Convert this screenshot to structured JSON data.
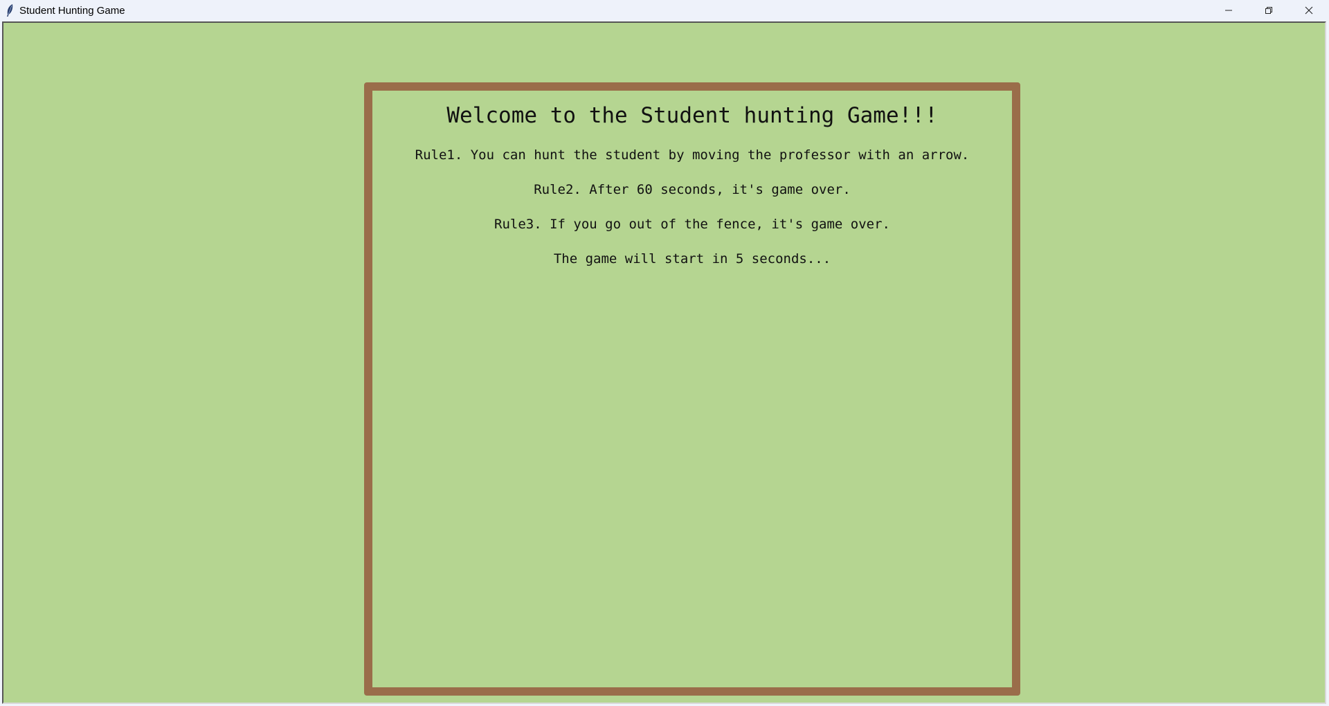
{
  "window": {
    "title": "Student Hunting Game",
    "icon": "feather-icon",
    "controls": [
      "minimize-icon",
      "restore-icon",
      "close-icon"
    ]
  },
  "game": {
    "background_color": "#b5d591",
    "fence_color": "#9a6d4a",
    "welcome": "Welcome to the Student hunting Game!!!",
    "rule1": "Rule1. You can hunt the student by moving the professor with an arrow.",
    "rule2": "Rule2. After 60 seconds, it's game over.",
    "rule3": "Rule3. If you go out of the fence, it's game over.",
    "countdown": "The game will start in 5 seconds..."
  }
}
